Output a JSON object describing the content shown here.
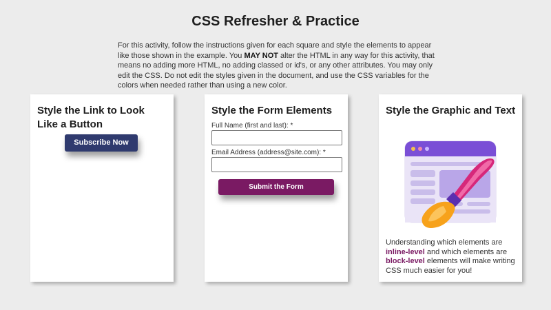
{
  "page": {
    "title": "CSS Refresher & Practice",
    "intro": {
      "part1": "For this activity, follow the instructions given for each square and style the elements to appear like those shown in the example. You ",
      "emphasis": "MAY NOT",
      "part2": " alter the HTML in any way for this activity, that means no adding more HTML, no adding classed or id's, or any other attributes. You may only edit the CSS. Do not edit the styles given in the document, and use the CSS variables for the colors when needed rather than using a new color."
    }
  },
  "cards": {
    "link": {
      "title": "Style the Link to Look Like a Button",
      "button_label": "Subscribe Now"
    },
    "form": {
      "title": "Style the Form Elements",
      "name_label": "Full Name (first and last): *",
      "name_value": "",
      "email_label": "Email Address (address@site.com): *",
      "email_value": "",
      "submit_label": "Submit the Form"
    },
    "graphic": {
      "title": "Style the Graphic and Text",
      "image_icon": "web-design-paintbrush-illustration",
      "text1": "Understanding which elements are ",
      "kw1": "inline-level",
      "text2": " and which elements are ",
      "kw2": "block-level",
      "text3": " elements will make writing CSS much easier for you!"
    }
  },
  "colors": {
    "background": "#ececec",
    "card": "#ffffff",
    "link_button": "#2f3a6e",
    "submit_button": "#7a1a63",
    "keyword": "#7a1a63",
    "browser_frame": "#7a4fd6",
    "browser_body": "#eae4f7"
  }
}
